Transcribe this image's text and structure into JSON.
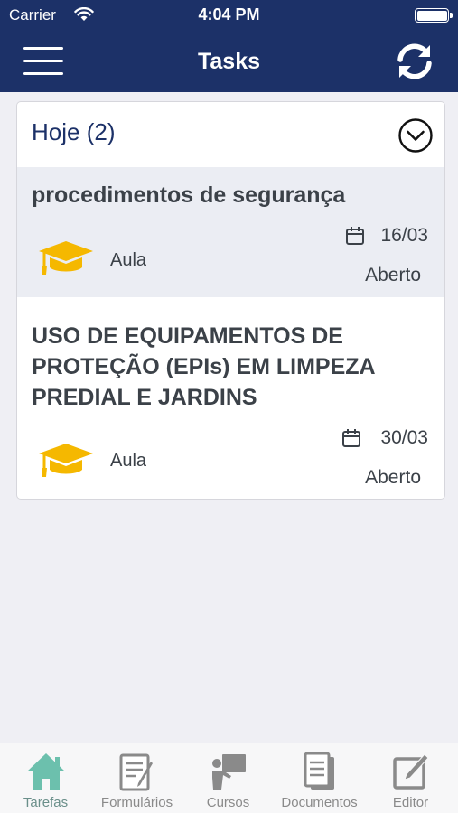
{
  "status_bar": {
    "carrier": "Carrier",
    "time": "4:04 PM"
  },
  "nav": {
    "title": "Tasks"
  },
  "section": {
    "title": "Hoje  (2)"
  },
  "tasks": [
    {
      "title": "procedimentos de segurança",
      "type": "Aula",
      "date": "16/03",
      "status": "Aberto"
    },
    {
      "title": "USO DE EQUIPAMENTOS DE PROTEÇÃO (EPIs) EM LIMPEZA PREDIAL E JARDINS",
      "type": "Aula",
      "date": "30/03",
      "status": "Aberto"
    }
  ],
  "tabs": [
    {
      "label": "Tarefas",
      "icon": "home-icon",
      "active": true
    },
    {
      "label": "Formulários",
      "icon": "form-icon",
      "active": false
    },
    {
      "label": "Cursos",
      "icon": "course-icon",
      "active": false
    },
    {
      "label": "Documentos",
      "icon": "documents-icon",
      "active": false
    },
    {
      "label": "Editor",
      "icon": "edit-icon",
      "active": false
    }
  ],
  "colors": {
    "header": "#1c3168",
    "highlight_row": "#ebedf3",
    "graduation_cap": "#f5b800",
    "active_tab": "#6cc0ad"
  }
}
